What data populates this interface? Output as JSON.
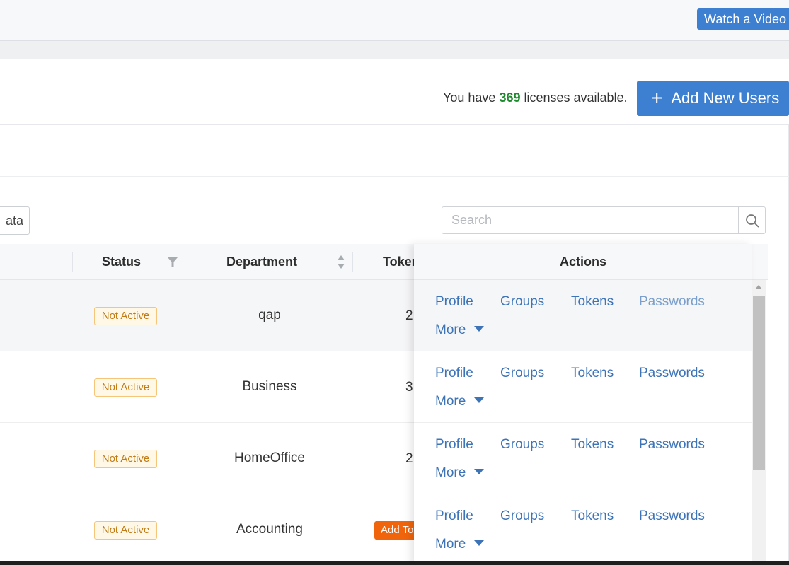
{
  "topbar": {
    "watch_video_label": "Watch a Video"
  },
  "licenses": {
    "prefix": "You have",
    "count": "369",
    "suffix": "licenses available."
  },
  "add_users": {
    "icon": "plus-icon",
    "label": "Add New Users"
  },
  "toolbar": {
    "data_button_label": "ata"
  },
  "search": {
    "placeholder": "Search",
    "value": "",
    "icon": "search-icon"
  },
  "table": {
    "columns": {
      "status": "Status",
      "department": "Department",
      "tokens": "Tokens",
      "actions": "Actions"
    },
    "rows": [
      {
        "status": "Not Active",
        "department": "qap",
        "tokens": "2",
        "token_button": ""
      },
      {
        "status": "Not Active",
        "department": "Business",
        "tokens": "3",
        "token_button": ""
      },
      {
        "status": "Not Active",
        "department": "HomeOffice",
        "tokens": "2",
        "token_button": ""
      },
      {
        "status": "Not Active",
        "department": "Accounting",
        "tokens": "",
        "token_button": "Add To"
      }
    ]
  },
  "actions": {
    "profile": "Profile",
    "groups": "Groups",
    "tokens": "Tokens",
    "passwords": "Passwords",
    "more": "More"
  },
  "colors": {
    "primary": "#3d7fd1",
    "license_count": "#1f8a2e",
    "badge_text": "#c37a12",
    "badge_border": "#f5c67a",
    "token_button": "#f0650c",
    "link": "#3d74b8"
  }
}
